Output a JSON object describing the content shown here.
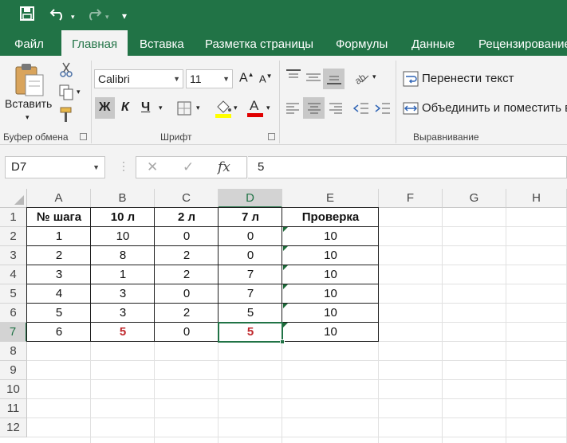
{
  "ribbon": {
    "tabs": [
      "Файл",
      "Главная",
      "Вставка",
      "Разметка страницы",
      "Формулы",
      "Данные",
      "Рецензирование"
    ],
    "active_tab": 1,
    "clipboard": {
      "paste_label": "Вставить",
      "group_label": "Буфер обмена"
    },
    "font": {
      "name": "Calibri",
      "size": "11",
      "bold": "Ж",
      "italic": "К",
      "underline": "Ч",
      "group_label": "Шрифт"
    },
    "alignment": {
      "wrap_label": "Перенести текст",
      "merge_label": "Объединить и поместить в",
      "group_label": "Выравнивание"
    },
    "colors": {
      "accent": "#217346",
      "fill_bar": "#ffff00",
      "font_bar": "#e00000"
    }
  },
  "formula_bar": {
    "name_box": "D7",
    "cancel": "✕",
    "enter": "✓",
    "fx": "fx",
    "value": "5"
  },
  "sheet": {
    "columns": [
      "A",
      "B",
      "C",
      "D",
      "E",
      "F",
      "G",
      "H"
    ],
    "rows": [
      "1",
      "2",
      "3",
      "4",
      "5",
      "6",
      "7",
      "8",
      "9",
      "10",
      "11",
      "12"
    ],
    "selected_column": "D",
    "selected_row": "7",
    "table_header": [
      "№ шага",
      "10 л",
      "2 л",
      "7 л",
      "Проверка"
    ],
    "table_rows": [
      [
        "1",
        "10",
        "0",
        "0",
        "10"
      ],
      [
        "2",
        "8",
        "2",
        "0",
        "10"
      ],
      [
        "3",
        "1",
        "2",
        "7",
        "10"
      ],
      [
        "4",
        "3",
        "0",
        "7",
        "10"
      ],
      [
        "5",
        "3",
        "2",
        "5",
        "10"
      ],
      [
        "6",
        "5",
        "0",
        "5",
        "10"
      ]
    ],
    "highlight_color": "#c0292d"
  }
}
